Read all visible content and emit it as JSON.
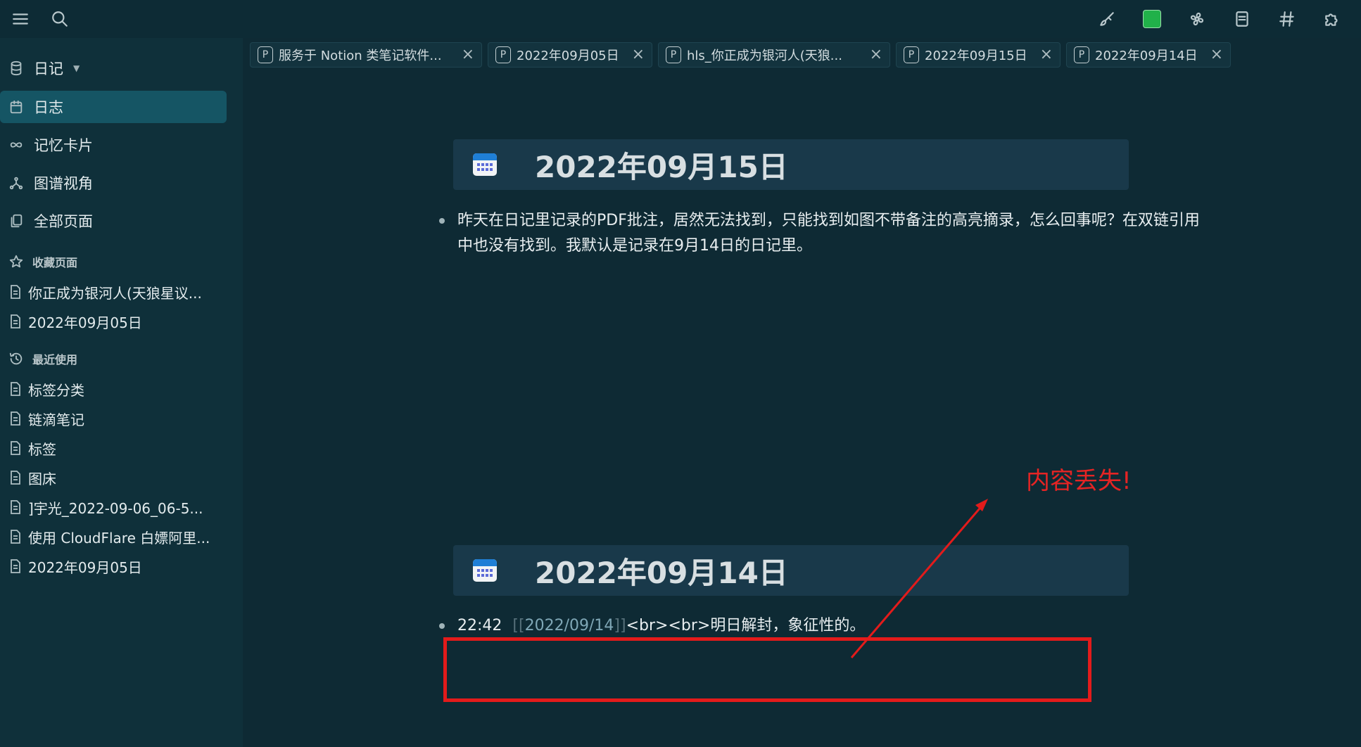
{
  "topbar": {
    "menu_icon": "hamburger-menu-icon",
    "search_icon": "search-icon",
    "right_icons": [
      "brush-icon",
      "green-square-icon",
      "fan-icon",
      "note-icon",
      "hashtag-icon",
      "puzzle-icon"
    ],
    "accent_green": "#21b14a"
  },
  "sidebar": {
    "graph_name": "日记",
    "nav": [
      {
        "label": "日志",
        "icon": "calendar-icon",
        "active": true
      },
      {
        "label": "记忆卡片",
        "icon": "infinity-icon",
        "active": false
      },
      {
        "label": "图谱视角",
        "icon": "graph-icon",
        "active": false
      },
      {
        "label": "全部页面",
        "icon": "pages-icon",
        "active": false
      }
    ],
    "favorites_title": "收藏页面",
    "favorites": [
      "你正成为银河人(天狼星议...",
      "2022年09月05日"
    ],
    "recent_title": "最近使用",
    "recent": [
      "标签分类",
      "链滴笔记",
      "标签",
      "图床",
      "]宇光_2022-09-06_06-5...",
      "使用 CloudFlare 白嫖阿里...",
      "2022年09月05日"
    ]
  },
  "tabs": [
    {
      "badge": "P",
      "label": "服务于 Notion 类笔记软件..."
    },
    {
      "badge": "P",
      "label": "2022年09月05日"
    },
    {
      "badge": "P",
      "label": "hls_你正成为银河人(天狼..."
    },
    {
      "badge": "P",
      "label": "2022年09月15日"
    },
    {
      "badge": "P",
      "label": "2022年09月14日"
    }
  ],
  "journals": [
    {
      "title": "2022年09月15日",
      "blocks": [
        "昨天在日记里记录的PDF批注，居然无法找到，只能找到如图不带备注的高亮摘录，怎么回事呢？在双链引用",
        "中也没有找到。我默认是记录在9月14日的日记里。"
      ]
    },
    {
      "title": "2022年09月14日",
      "block_time": "22:42",
      "block_bracket_open": "[[",
      "block_link": "2022/09/14",
      "block_bracket_close": "]]",
      "block_text": "<br><br>明日解封，象征性的。"
    }
  ],
  "annotation": {
    "text": "内容丢失!",
    "color": "#e52424"
  }
}
